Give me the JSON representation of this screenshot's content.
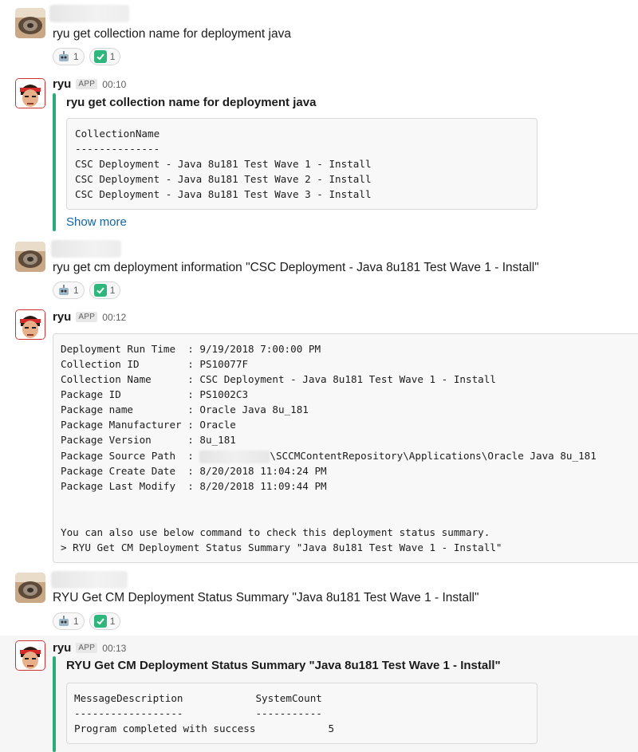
{
  "app": {
    "name": "ryu",
    "badge": "APP"
  },
  "messages": {
    "m1": {
      "text": "ryu get collection name for deployment java",
      "reactions": [
        {
          "emoji": "robot-face-icon",
          "count": "1"
        },
        {
          "emoji": "check-mark-icon",
          "count": "1"
        }
      ]
    },
    "b1": {
      "time": "00:10",
      "title": "ryu get collection name for deployment java",
      "lines": [
        "CollectionName",
        "--------------",
        "CSC Deployment - Java 8u181 Test Wave 1 - Install",
        "CSC Deployment - Java 8u181 Test Wave 2 - Install",
        "CSC Deployment - Java 8u181 Test Wave 3 - Install"
      ],
      "show_more": "Show more"
    },
    "m2": {
      "text": "ryu get cm deployment information \"CSC Deployment - Java 8u181 Test Wave 1 - Install\"",
      "reactions": [
        {
          "emoji": "robot-face-icon",
          "count": "1"
        },
        {
          "emoji": "check-mark-icon",
          "count": "1"
        }
      ]
    },
    "b2": {
      "time": "00:12",
      "lines": [
        "Deployment Run Time  : 9/19/2018 7:00:00 PM",
        "Collection ID        : PS10077F",
        "Collection Name      : CSC Deployment - Java 8u181 Test Wave 1 - Install",
        "Package ID           : PS1002C3",
        "Package name         : Oracle Java 8u_181",
        "Package Manufacturer : Oracle",
        "Package Version      : 8u_181"
      ],
      "source_label": "Package Source Path  : ",
      "source_value": "\\SCCMContentRepository\\Applications\\Oracle Java 8u_181",
      "lines2": [
        "Package Create Date  : 8/20/2018 11:04:24 PM",
        "Package Last Modify  : 8/20/2018 11:09:44 PM"
      ],
      "hint": "You can also use below command to check this deployment status summary.",
      "command": "> RYU Get CM Deployment Status Summary \"Java 8u181 Test Wave 1 - Install\""
    },
    "m3": {
      "text": "RYU Get CM Deployment Status Summary \"Java 8u181 Test Wave 1 - Install\"",
      "reactions": [
        {
          "emoji": "robot-face-icon",
          "count": "1"
        },
        {
          "emoji": "check-mark-icon",
          "count": "1"
        }
      ]
    },
    "b3": {
      "time": "00:13",
      "title": "RYU Get CM Deployment Status Summary \"Java 8u181 Test Wave 1 - Install\"",
      "lines": [
        "MessageDescription            SystemCount",
        "------------------            -----------",
        "Program completed with success            5"
      ]
    }
  },
  "colors": {
    "attachment_bar": "#2bac76",
    "link": "#1264a3",
    "check": "#2eb67d"
  }
}
